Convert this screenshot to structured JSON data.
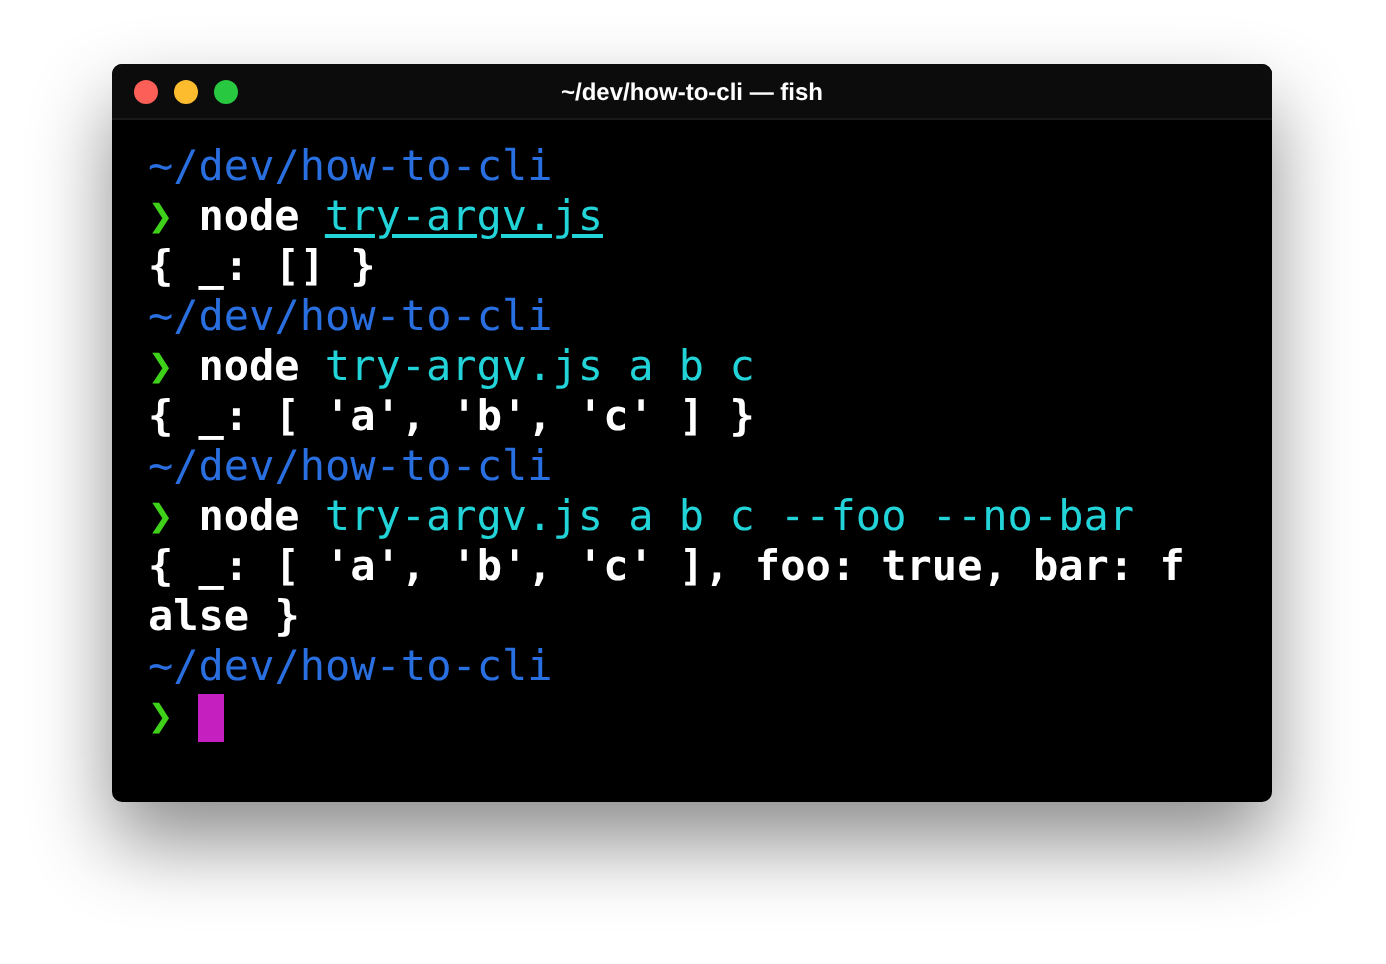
{
  "window": {
    "title": "~/dev/how-to-cli — fish"
  },
  "terminal": {
    "lines": [
      {
        "kind": "path",
        "text": "~/dev/how-to-cli"
      },
      {
        "kind": "command",
        "prompt": "❯",
        "program": "node",
        "args": [
          {
            "text": "try-argv.js",
            "underlined": true
          }
        ]
      },
      {
        "kind": "output",
        "text": "{ _: [] }"
      },
      {
        "kind": "path",
        "text": "~/dev/how-to-cli"
      },
      {
        "kind": "command",
        "prompt": "❯",
        "program": "node",
        "args": [
          {
            "text": "try-argv.js a b c",
            "underlined": false
          }
        ]
      },
      {
        "kind": "output",
        "text": "{ _: [ 'a', 'b', 'c' ] }"
      },
      {
        "kind": "path",
        "text": "~/dev/how-to-cli"
      },
      {
        "kind": "command",
        "prompt": "❯",
        "program": "node",
        "args": [
          {
            "text": "try-argv.js a b c --foo --no-bar",
            "underlined": false
          }
        ]
      },
      {
        "kind": "output",
        "text": "{ _: [ 'a', 'b', 'c' ], foo: true, bar: f"
      },
      {
        "kind": "output",
        "text": "alse }"
      },
      {
        "kind": "path",
        "text": "~/dev/how-to-cli"
      },
      {
        "kind": "input",
        "prompt": "❯"
      }
    ]
  }
}
